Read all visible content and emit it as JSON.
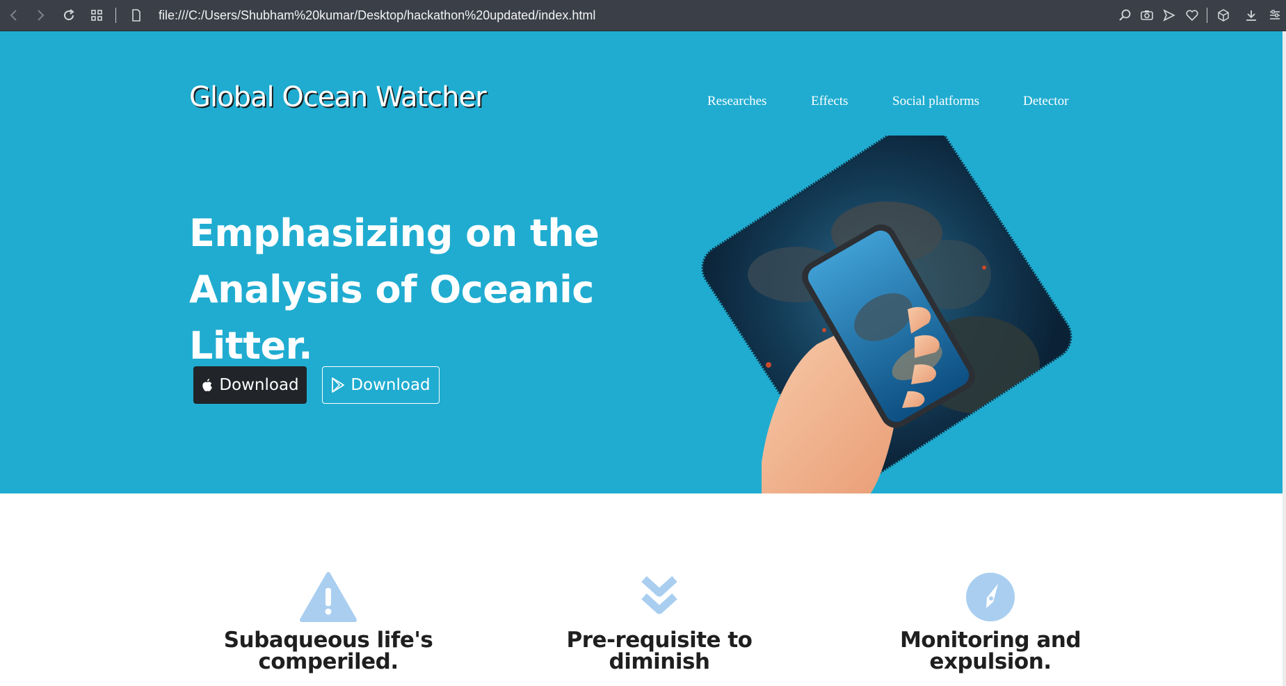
{
  "browser": {
    "url": "file:///C:/Users/Shubham%20kumar/Desktop/hackathon%20updated/index.html",
    "toolbar_icons": [
      "back-icon",
      "forward-icon",
      "reload-icon",
      "speed-dial-icon",
      "page-icon",
      "search-icon",
      "camera-icon",
      "send-icon",
      "heart-icon",
      "cube-icon",
      "download-icon",
      "menu-icon"
    ]
  },
  "site": {
    "brand": "Global Ocean Watcher",
    "nav": [
      "Researches",
      "Effects",
      "Social platforms",
      "Detector"
    ],
    "hero": {
      "headline_lines": [
        "Emphasizing on the",
        "Analysis of Oceanic",
        "Litter."
      ],
      "buttons": [
        {
          "label": "Download",
          "icon": "apple-icon",
          "style": "dark"
        },
        {
          "label": "Download",
          "icon": "play-store-icon",
          "style": "outline"
        }
      ]
    },
    "features": [
      {
        "icon": "warning-triangle-icon",
        "title_lines": [
          "Subaqueous life's",
          "comperiled."
        ]
      },
      {
        "icon": "double-chevron-down-icon",
        "title_lines": [
          "Pre-requisite to",
          "diminish"
        ]
      },
      {
        "icon": "compass-icon",
        "title_lines": [
          "Monitoring and",
          "expulsion."
        ]
      }
    ]
  },
  "colors": {
    "hero_bg": "#20acd0",
    "chrome_bg": "#3b4048",
    "icon_light_blue": "#a9cef0",
    "button_dark": "#212529"
  }
}
